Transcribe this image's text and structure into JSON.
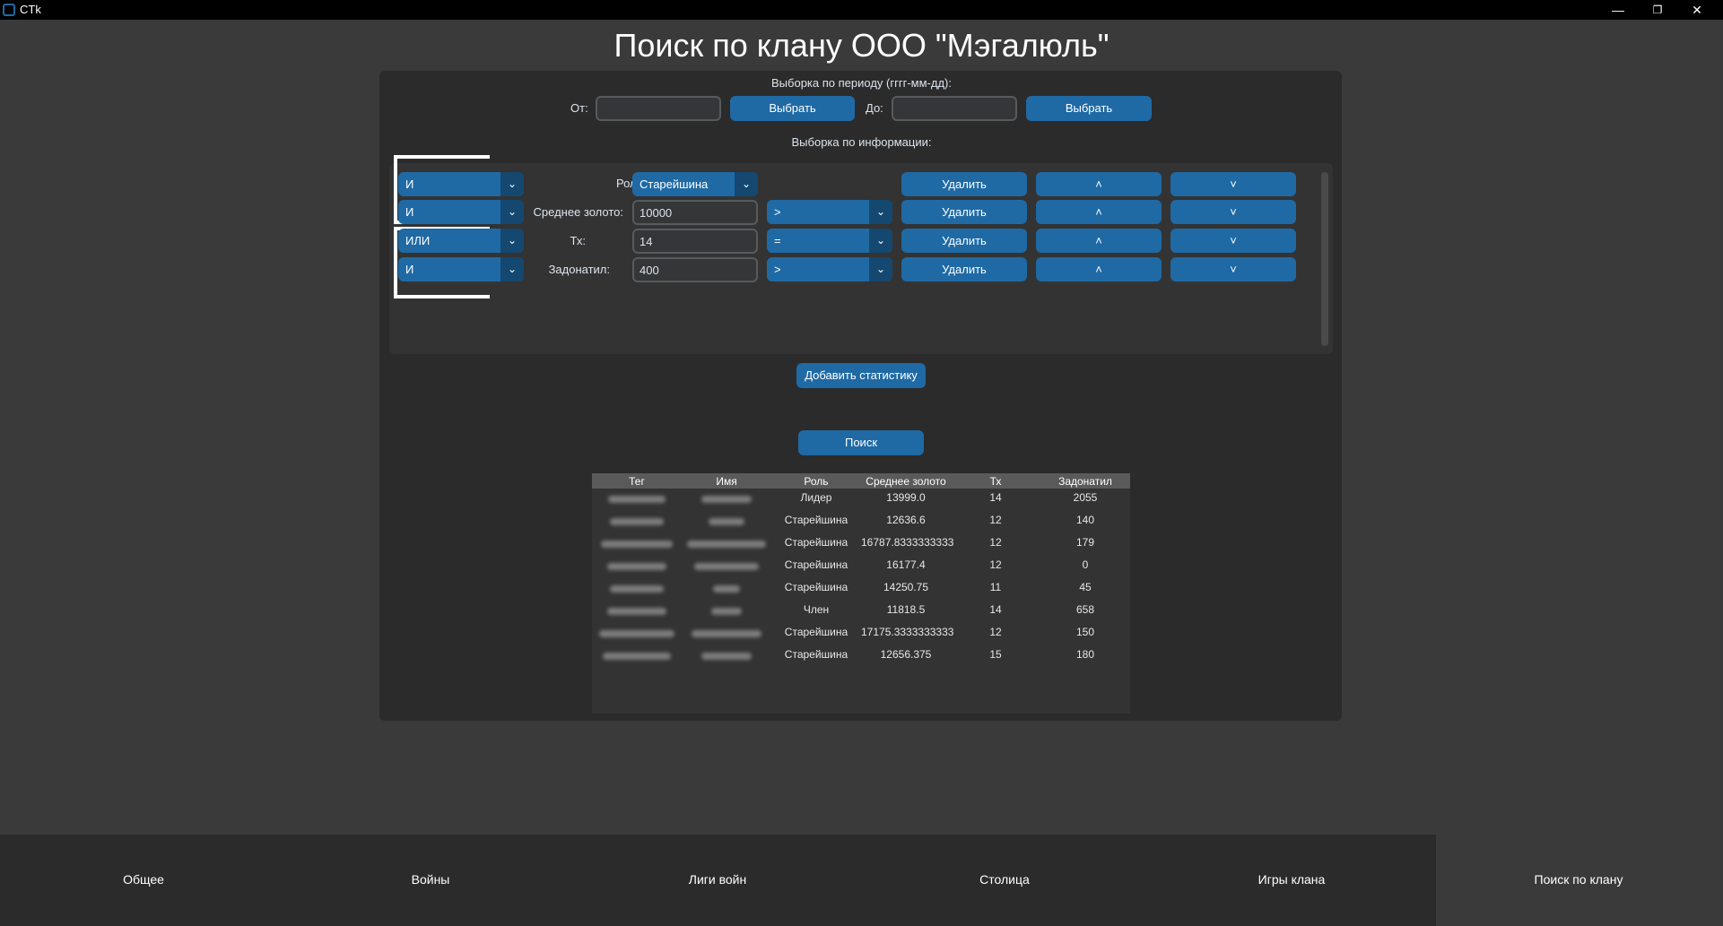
{
  "window": {
    "app_title": "CTk",
    "minimize_icon": "—",
    "maximize_icon": "❐",
    "close_icon": "✕"
  },
  "page_title": "Поиск по клану ООО \"Мэгалюль\"",
  "period": {
    "heading": "Выборка по периоду (гггг-мм-дд):",
    "from_label": "От:",
    "from_value": "",
    "from_pick": "Выбрать",
    "to_label": "До:",
    "to_value": "",
    "to_pick": "Выбрать"
  },
  "info_heading": "Выборка по информации:",
  "filters": [
    {
      "logic": "И",
      "label": "Роль:",
      "value": "Старейшина",
      "value_is_combo": true,
      "op": "",
      "delete": "Удалить",
      "up_icon": "˄",
      "down_icon": "˅"
    },
    {
      "logic": "И",
      "label": "Среднее золото:",
      "value": "10000",
      "value_is_combo": false,
      "op": ">",
      "delete": "Удалить",
      "up_icon": "˄",
      "down_icon": "˅"
    },
    {
      "logic": "ИЛИ",
      "label": "Тх:",
      "value": "14",
      "value_is_combo": false,
      "op": "=",
      "delete": "Удалить",
      "up_icon": "˄",
      "down_icon": "˅"
    },
    {
      "logic": "И",
      "label": "Задонатил:",
      "value": "400",
      "value_is_combo": false,
      "op": ">",
      "delete": "Удалить",
      "up_icon": "˄",
      "down_icon": "˅"
    }
  ],
  "add_stat_button": "Добавить статистику",
  "search_button": "Поиск",
  "table": {
    "headers": [
      "Тег",
      "Имя",
      "Роль",
      "Среднее золото",
      "Тх",
      "Задонатил"
    ],
    "rows": [
      [
        "Лидер",
        "13999.0",
        "14",
        "2055"
      ],
      [
        "Старейшина",
        "12636.6",
        "12",
        "140"
      ],
      [
        "Старейшина",
        "16787.8333333333",
        "12",
        "179"
      ],
      [
        "Старейшина",
        "16177.4",
        "12",
        "0"
      ],
      [
        "Старейшина",
        "14250.75",
        "11",
        "45"
      ],
      [
        "Член",
        "11818.5",
        "14",
        "658"
      ],
      [
        "Старейшина",
        "17175.3333333333",
        "12",
        "150"
      ],
      [
        "Старейшина",
        "12656.375",
        "15",
        "180"
      ]
    ]
  },
  "nav": [
    "Общее",
    "Войны",
    "Лиги войн",
    "Столица",
    "Игры клана",
    "Поиск по клану"
  ],
  "colors": {
    "accent": "#1f6aa5",
    "accent_dark": "#144870",
    "background": "#3a3a3a",
    "panel": "#2b2b2b"
  }
}
